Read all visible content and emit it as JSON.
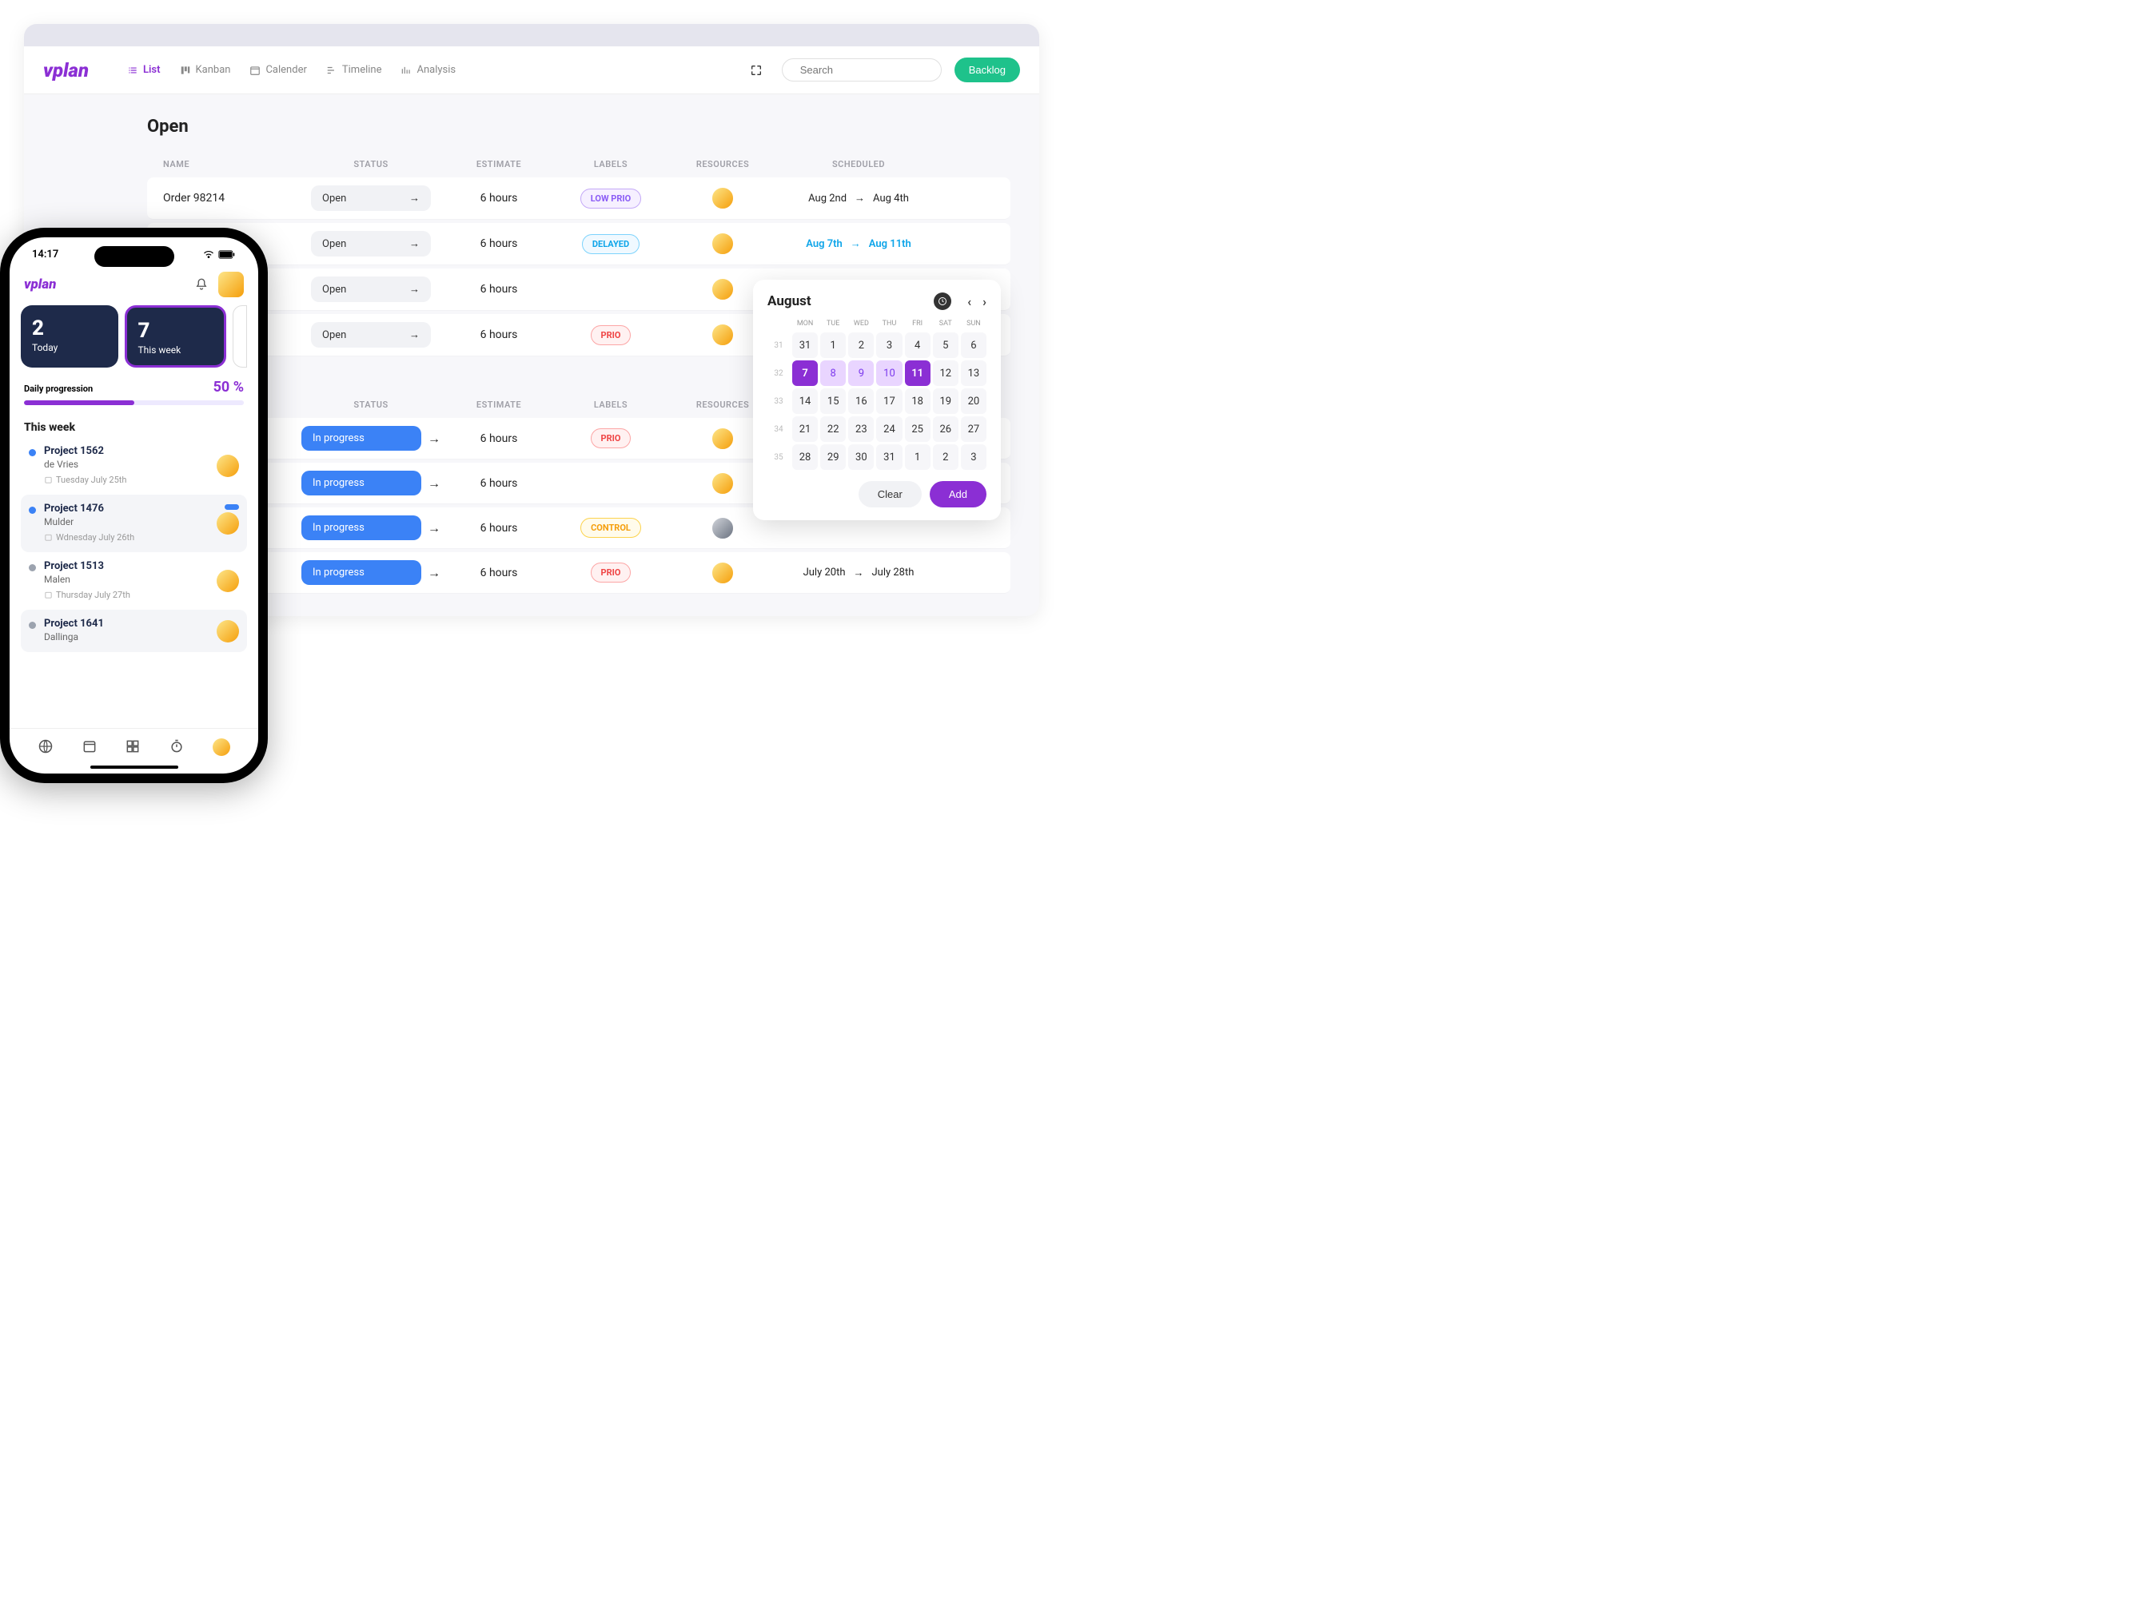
{
  "brand": "vplan",
  "desktop": {
    "tabs": {
      "list": "List",
      "kanban": "Kanban",
      "calendar": "Calender",
      "timeline": "Timeline",
      "analysis": "Analysis"
    },
    "search_placeholder": "Search",
    "backlog_label": "Backlog",
    "section_open": "Open",
    "columns": {
      "name": "NAME",
      "status": "STATUS",
      "estimate": "ESTIMATE",
      "labels": "LABELS",
      "resources": "RESOURCES",
      "scheduled": "SCHEDULED"
    },
    "open_rows": [
      {
        "name": "Order 98214",
        "status": "Open",
        "estimate": "6 hours",
        "label": "LOW PRIO",
        "label_class": "lowprio",
        "from": "Aug 2nd",
        "to": "Aug 4th",
        "active": false
      },
      {
        "name": "",
        "status": "Open",
        "estimate": "6 hours",
        "label": "DELAYED",
        "label_class": "delayed",
        "from": "Aug 7th",
        "to": "Aug 11th",
        "active": true
      },
      {
        "name": "",
        "status": "Open",
        "estimate": "6 hours",
        "label": "",
        "label_class": "",
        "from": "",
        "to": "",
        "active": false
      },
      {
        "name": "",
        "status": "Open",
        "estimate": "6 hours",
        "label": "PRIO",
        "label_class": "prio",
        "from": "",
        "to": "",
        "active": false
      }
    ],
    "progress_rows": [
      {
        "status": "In progress",
        "estimate": "6 hours",
        "label": "PRIO",
        "label_class": "prio",
        "from": "",
        "to": ""
      },
      {
        "status": "In progress",
        "estimate": "6 hours",
        "label": "",
        "label_class": "",
        "from": "",
        "to": ""
      },
      {
        "status": "In progress",
        "estimate": "6 hours",
        "label": "CONTROL",
        "label_class": "control",
        "from": "",
        "to": ""
      },
      {
        "status": "In progress",
        "estimate": "6 hours",
        "label": "PRIO",
        "label_class": "prio",
        "from": "July 20th",
        "to": "July 28th"
      }
    ]
  },
  "datepicker": {
    "month": "August",
    "dow": [
      "MON",
      "TUE",
      "WED",
      "THU",
      "FRI",
      "SAT",
      "SUN"
    ],
    "weeks": [
      {
        "wk": "31",
        "days": [
          "31",
          "1",
          "2",
          "3",
          "4",
          "5",
          "6"
        ],
        "state": [
          "",
          "",
          "",
          "",
          "",
          "",
          ""
        ]
      },
      {
        "wk": "32",
        "days": [
          "7",
          "8",
          "9",
          "10",
          "11",
          "12",
          "13"
        ],
        "state": [
          "selected",
          "range",
          "range",
          "range",
          "selected",
          "",
          ""
        ]
      },
      {
        "wk": "33",
        "days": [
          "14",
          "15",
          "16",
          "17",
          "18",
          "19",
          "20"
        ],
        "state": [
          "",
          "",
          "",
          "",
          "",
          "",
          ""
        ]
      },
      {
        "wk": "34",
        "days": [
          "21",
          "22",
          "23",
          "24",
          "25",
          "26",
          "27"
        ],
        "state": [
          "",
          "",
          "",
          "",
          "",
          "",
          ""
        ]
      },
      {
        "wk": "35",
        "days": [
          "28",
          "29",
          "30",
          "31",
          "1",
          "2",
          "3"
        ],
        "state": [
          "",
          "",
          "",
          "",
          "",
          "",
          ""
        ]
      }
    ],
    "clear_label": "Clear",
    "add_label": "Add"
  },
  "mobile": {
    "time": "14:17",
    "stat_today_num": "2",
    "stat_today_label": "Today",
    "stat_week_num": "7",
    "stat_week_label": "This week",
    "progress_label": "Daily progression",
    "progress_value": "50 %",
    "section": "This week",
    "items": [
      {
        "title": "Project 1562",
        "sub": "de Vries",
        "date": "Tuesday July 25th",
        "dot": "#3b82f6",
        "badge": false,
        "alt": false
      },
      {
        "title": "Project 1476",
        "sub": "Mulder",
        "date": "Wdnesday July 26th",
        "dot": "#3b82f6",
        "badge": true,
        "alt": true
      },
      {
        "title": "Project 1513",
        "sub": "Malen",
        "date": "Thursday July 27th",
        "dot": "#9ca3af",
        "badge": false,
        "alt": false
      },
      {
        "title": "Project 1641",
        "sub": "Dallinga",
        "date": "",
        "dot": "#9ca3af",
        "badge": false,
        "alt": true
      }
    ]
  }
}
